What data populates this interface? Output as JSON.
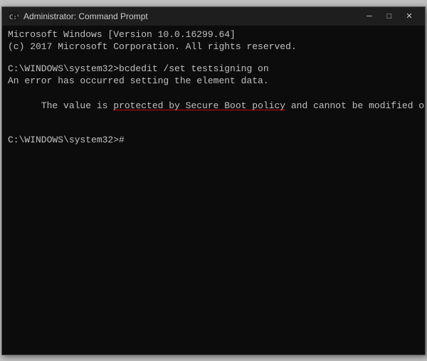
{
  "window": {
    "title": "Administrator: Command Prompt",
    "icon": "cmd-icon"
  },
  "title_bar": {
    "minimize_label": "─",
    "maximize_label": "□",
    "close_label": "✕"
  },
  "console": {
    "line1": "Microsoft Windows [Version 10.0.16299.64]",
    "line2": "(c) 2017 Microsoft Corporation. All rights reserved.",
    "line3": "",
    "line4": "C:\\WINDOWS\\system32>bcdedit /set testsigning on",
    "line5": "An error has occurred setting the element data.",
    "line6_part1": "The value is ",
    "line6_underlined": "protected by Secure Boot policy",
    "line6_part2": " and cannot be modified or deleted.",
    "line7": "",
    "line8": "C:\\WINDOWS\\system32>#"
  }
}
